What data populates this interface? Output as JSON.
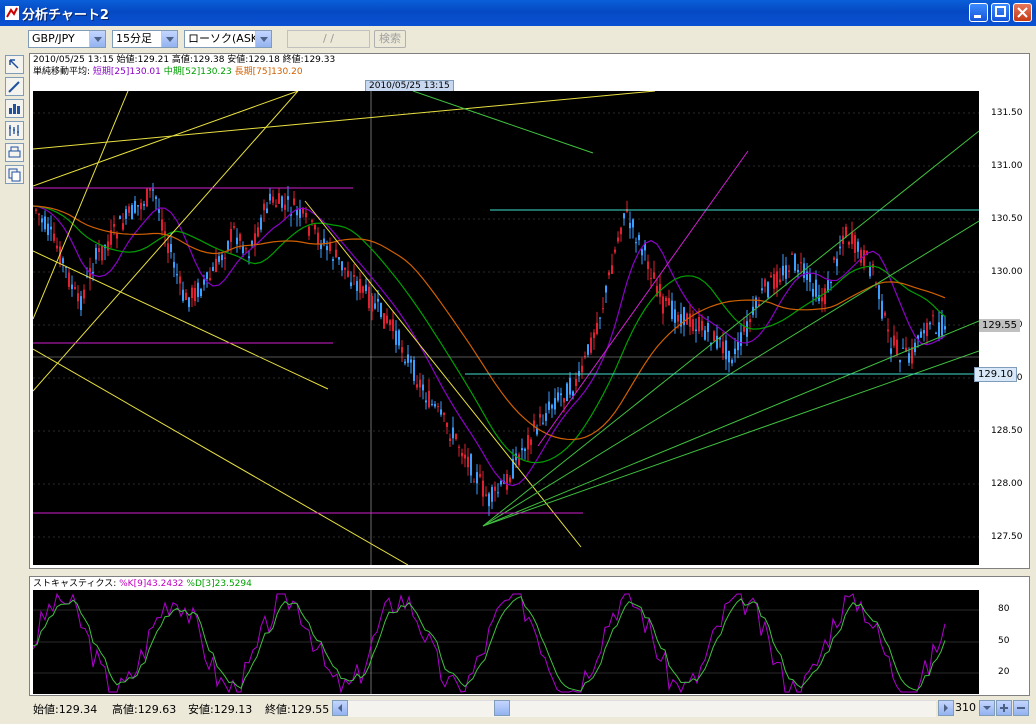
{
  "window": {
    "title": "分析チャート2"
  },
  "toolbar": {
    "pair": "GBP/JPY",
    "timeframe": "15分足",
    "chart_type": "ローソク(ASK)",
    "date_placeholder": "/ /",
    "search_label": "検索"
  },
  "info": {
    "ohlc_line": "2010/05/25 13:15  始値:129.21  高値:129.38  安値:129.18  終値:129.33",
    "ma_label": "単純移動平均:",
    "ma_short": "短期[25]130.01",
    "ma_mid": "中期[52]130.23",
    "ma_long": "長期[75]130.20"
  },
  "cursor_date": "2010/05/25 13:15",
  "price_axis": [
    "131.50",
    "131.00",
    "130.50",
    "130.00",
    "129.50",
    "129.00",
    "128.50",
    "128.00",
    "127.50"
  ],
  "price_tags": {
    "current": "129.55",
    "line": "129.10"
  },
  "stochastics": {
    "label": "ストキャスティクス:",
    "k": "%K[9]43.2432",
    "d": "%D[3]23.5294",
    "axis": [
      "80",
      "50",
      "20"
    ]
  },
  "status": {
    "open": "始値:129.34",
    "high": "高値:129.63",
    "low": "安値:129.13",
    "close": "終値:129.55",
    "count": "310"
  },
  "colors": {
    "ma_short": "#8b00c8",
    "ma_mid": "#00a000",
    "ma_long": "#d06000",
    "candle_up": "#3aa0ff",
    "candle_down": "#e02030",
    "trend_yellow": "#e8e040",
    "trend_green": "#40c040",
    "trend_magenta": "#d020d0",
    "trend_cyan": "#40e0d0"
  },
  "icons": [
    "pointer-icon",
    "pencil-icon",
    "bar-chart-icon",
    "indicator-icon",
    "print-icon",
    "copy-icon",
    "minimize-icon",
    "maximize-icon",
    "close-icon"
  ]
}
